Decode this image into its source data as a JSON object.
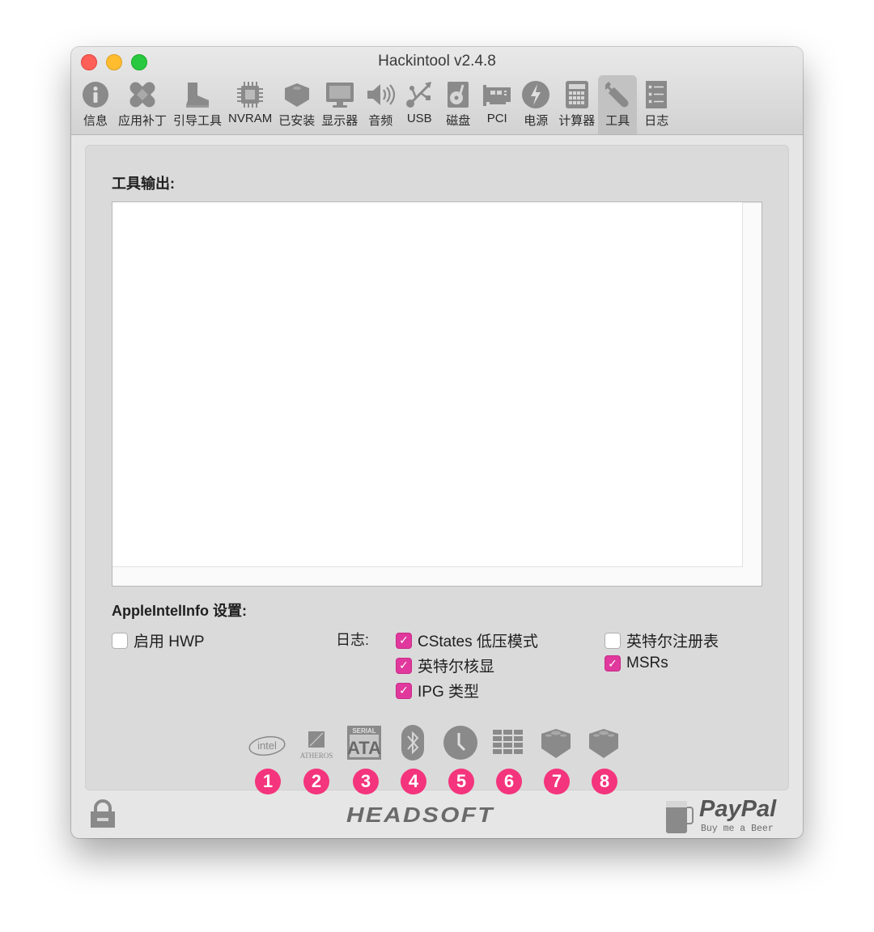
{
  "window": {
    "title": "Hackintool v2.4.8"
  },
  "toolbar": {
    "items": [
      {
        "label": "信息",
        "icon": "info-icon"
      },
      {
        "label": "应用补丁",
        "icon": "bandage-icon"
      },
      {
        "label": "引导工具",
        "icon": "boot-icon"
      },
      {
        "label": "NVRAM",
        "icon": "chip-icon"
      },
      {
        "label": "已安装",
        "icon": "kext-brick-icon"
      },
      {
        "label": "显示器",
        "icon": "display-icon"
      },
      {
        "label": "音频",
        "icon": "speaker-icon"
      },
      {
        "label": "USB",
        "icon": "usb-icon"
      },
      {
        "label": "磁盘",
        "icon": "disk-icon"
      },
      {
        "label": "PCI",
        "icon": "pci-card-icon"
      },
      {
        "label": "电源",
        "icon": "power-icon"
      },
      {
        "label": "计算器",
        "icon": "calculator-icon"
      },
      {
        "label": "工具",
        "icon": "wrench-icon",
        "active": true
      },
      {
        "label": "日志",
        "icon": "log-list-icon"
      }
    ]
  },
  "main": {
    "output_title": "工具输出:",
    "output_text": "",
    "settings_title": "AppleIntelInfo 设置:",
    "enable_hwp": {
      "label": "启用 HWP",
      "checked": false
    },
    "log_label": "日志:",
    "log_options": [
      {
        "label": "CStates 低压模式",
        "checked": true
      },
      {
        "label": "英特尔核显",
        "checked": true
      },
      {
        "label": "IPG 类型",
        "checked": true
      },
      {
        "label": "英特尔注册表",
        "checked": false
      },
      {
        "label": "MSRs",
        "checked": true
      }
    ],
    "check_glyph": "✓"
  },
  "hardware_icons": [
    {
      "name": "intel-logo-icon",
      "badge": "1",
      "text": "intel"
    },
    {
      "name": "atheros-logo-icon",
      "badge": "2",
      "text": "ATHEROS"
    },
    {
      "name": "serial-ata-icon",
      "badge": "3",
      "text": "SERIAL ATA"
    },
    {
      "name": "bluetooth-icon",
      "badge": "4"
    },
    {
      "name": "clock-icon",
      "badge": "5"
    },
    {
      "name": "grid-icon",
      "badge": "6"
    },
    {
      "name": "kext-brick-icon",
      "badge": "7"
    },
    {
      "name": "kext-brick-icon",
      "badge": "8"
    }
  ],
  "footer": {
    "brand": "HEADSOFT",
    "paypal": "PayPal",
    "paypal_sub": "Buy me a Beer"
  },
  "colors": {
    "accent_checkbox": "#e0389c",
    "badge": "#f4347c",
    "icon_gray": "#8a8a8a"
  }
}
